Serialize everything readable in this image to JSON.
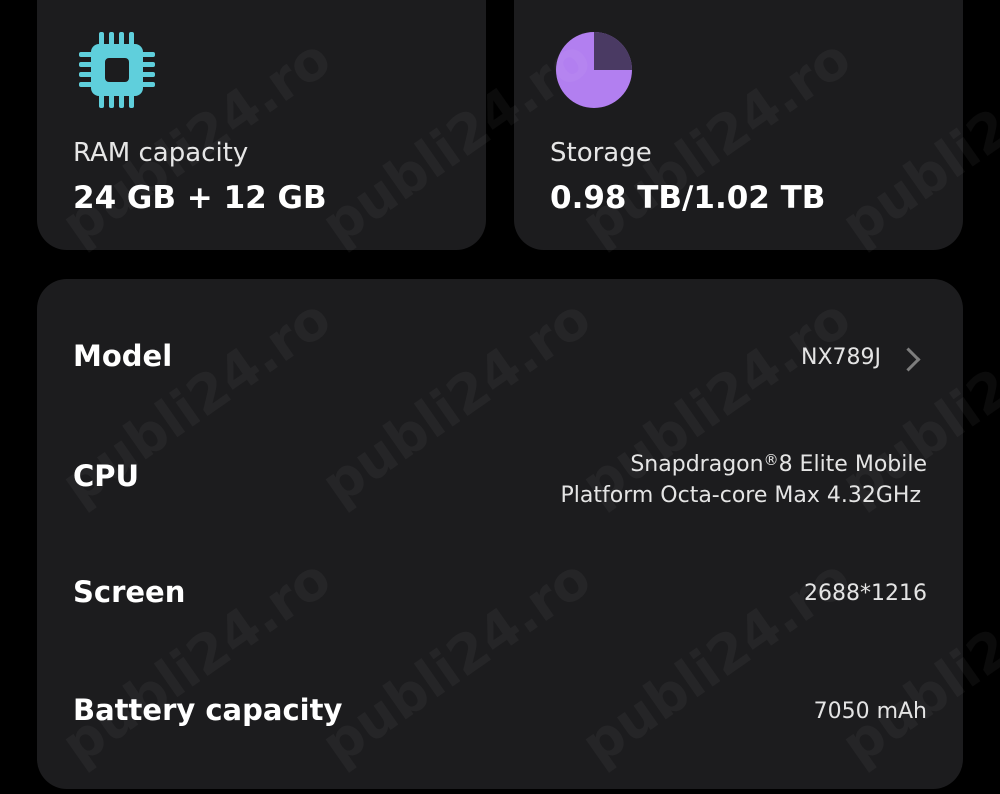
{
  "ram_card": {
    "icon": "cpu-chip-icon",
    "label": "RAM capacity",
    "value": "24 GB + 12 GB",
    "icon_color": "#5fcfdc"
  },
  "storage_card": {
    "icon": "pie-chart-icon",
    "label": "Storage",
    "value": "0.98 TB/1.02 TB",
    "used_fraction": 0.96,
    "icon_color": "#b27ff0"
  },
  "specs": {
    "model": {
      "label": "Model",
      "value": "NX789J"
    },
    "cpu": {
      "label": "CPU",
      "value_line1_a": "Snapdragon",
      "value_line1_reg": "®",
      "value_line1_b": "8 Elite Mobile",
      "value_line2": "Platform Octa-core Max 4.32GHz"
    },
    "screen": {
      "label": "Screen",
      "value": "2688*1216"
    },
    "battery": {
      "label": "Battery capacity",
      "value": "7050 mAh"
    }
  },
  "watermark": {
    "text": "publi24.ro"
  },
  "colors": {
    "background": "#000000",
    "card": "#1c1c1e",
    "text": "#ffffff",
    "secondary_text": "#e4e4e4",
    "chevron": "#7d7d7d"
  }
}
